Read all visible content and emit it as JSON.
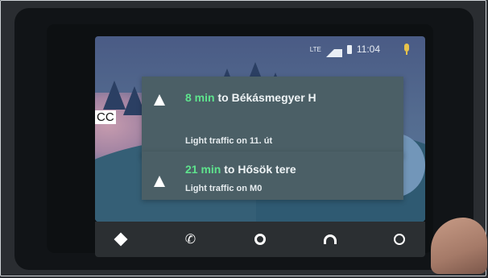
{
  "statusbar": {
    "time": "11:04",
    "network": "LTE"
  },
  "cards": [
    {
      "minutes": "8 min",
      "to_text": " to ",
      "destination": "Békásmegyer H",
      "traffic": "Light traffic on 11. út"
    },
    {
      "minutes": "21 min",
      "to_text": " to ",
      "destination": "Hősök tere",
      "traffic": "Light traffic on M0"
    }
  ],
  "overlay_text": "CC",
  "navbar": {
    "items": [
      "navigation",
      "phone",
      "home",
      "audio",
      "recents"
    ]
  },
  "colors": {
    "accent_green": "#5ee38d",
    "card_bg": "#4b5f66",
    "mic_yellow": "#e8c34a"
  }
}
